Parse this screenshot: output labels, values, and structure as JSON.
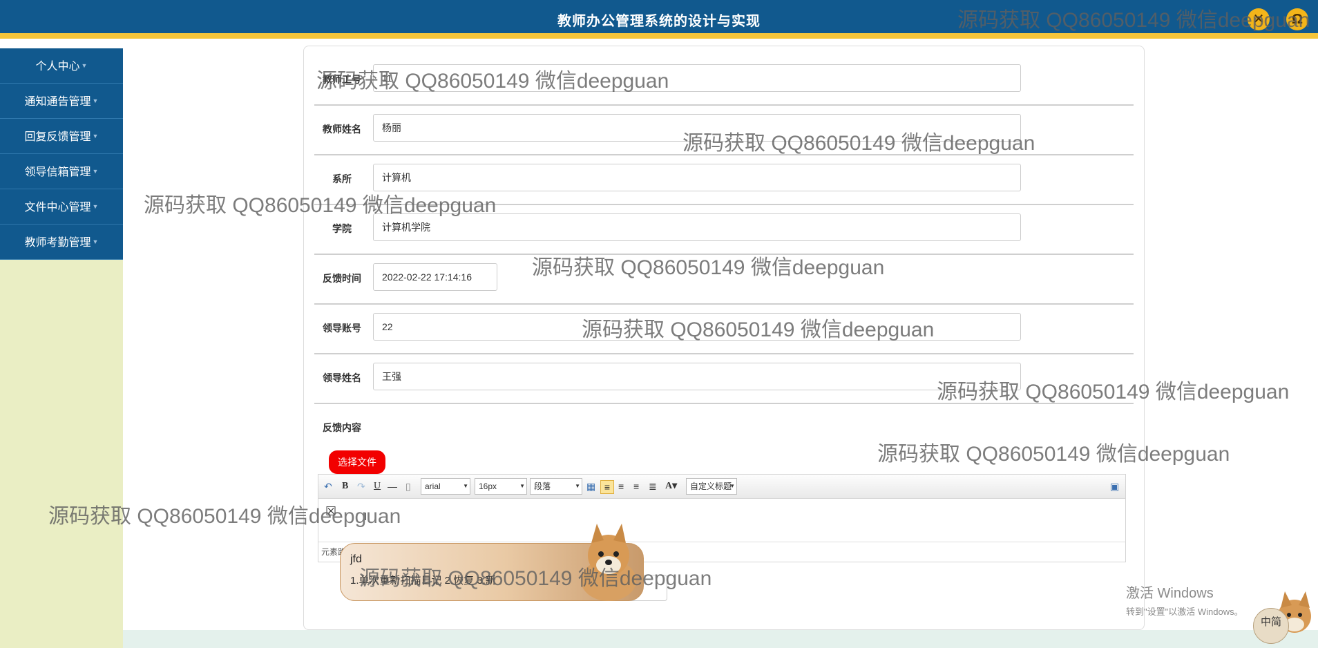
{
  "header": {
    "title": "教师办公管理系统的设计与实现",
    "close_icon": "✕",
    "user_icon": "Ω"
  },
  "sidebar": {
    "items": [
      {
        "label": "个人中心"
      },
      {
        "label": "通知通告管理"
      },
      {
        "label": "回复反馈管理"
      },
      {
        "label": "领导信箱管理"
      },
      {
        "label": "文件中心管理"
      },
      {
        "label": "教师考勤管理"
      }
    ]
  },
  "form": {
    "fields": [
      {
        "label": "教师工号",
        "value": "11"
      },
      {
        "label": "教师姓名",
        "value": "杨丽"
      },
      {
        "label": "系所",
        "value": "计算机"
      },
      {
        "label": "学院",
        "value": "计算机学院"
      },
      {
        "label": "反馈时间",
        "value": "2022-02-22 17:14:16"
      },
      {
        "label": "领导账号",
        "value": "22"
      },
      {
        "label": "领导姓名",
        "value": "王强"
      }
    ],
    "content_label": "反馈内容",
    "file_button": "选择文件",
    "editor": {
      "font_family": "arial",
      "font_size": "16px",
      "paragraph": "段落",
      "custom_title": "自定义标题",
      "footer": "元素路径:"
    }
  },
  "ime_popup": {
    "title": "jfd",
    "line": "1.单次重新扫描日记 2.恢复 3.新"
  },
  "watermark": "源码获取 QQ86050149 微信deepguan",
  "activate_windows": {
    "line1": "激活 Windows",
    "line2": "转到\"设置\"以激活 Windows。"
  },
  "ime_badge": "中简"
}
